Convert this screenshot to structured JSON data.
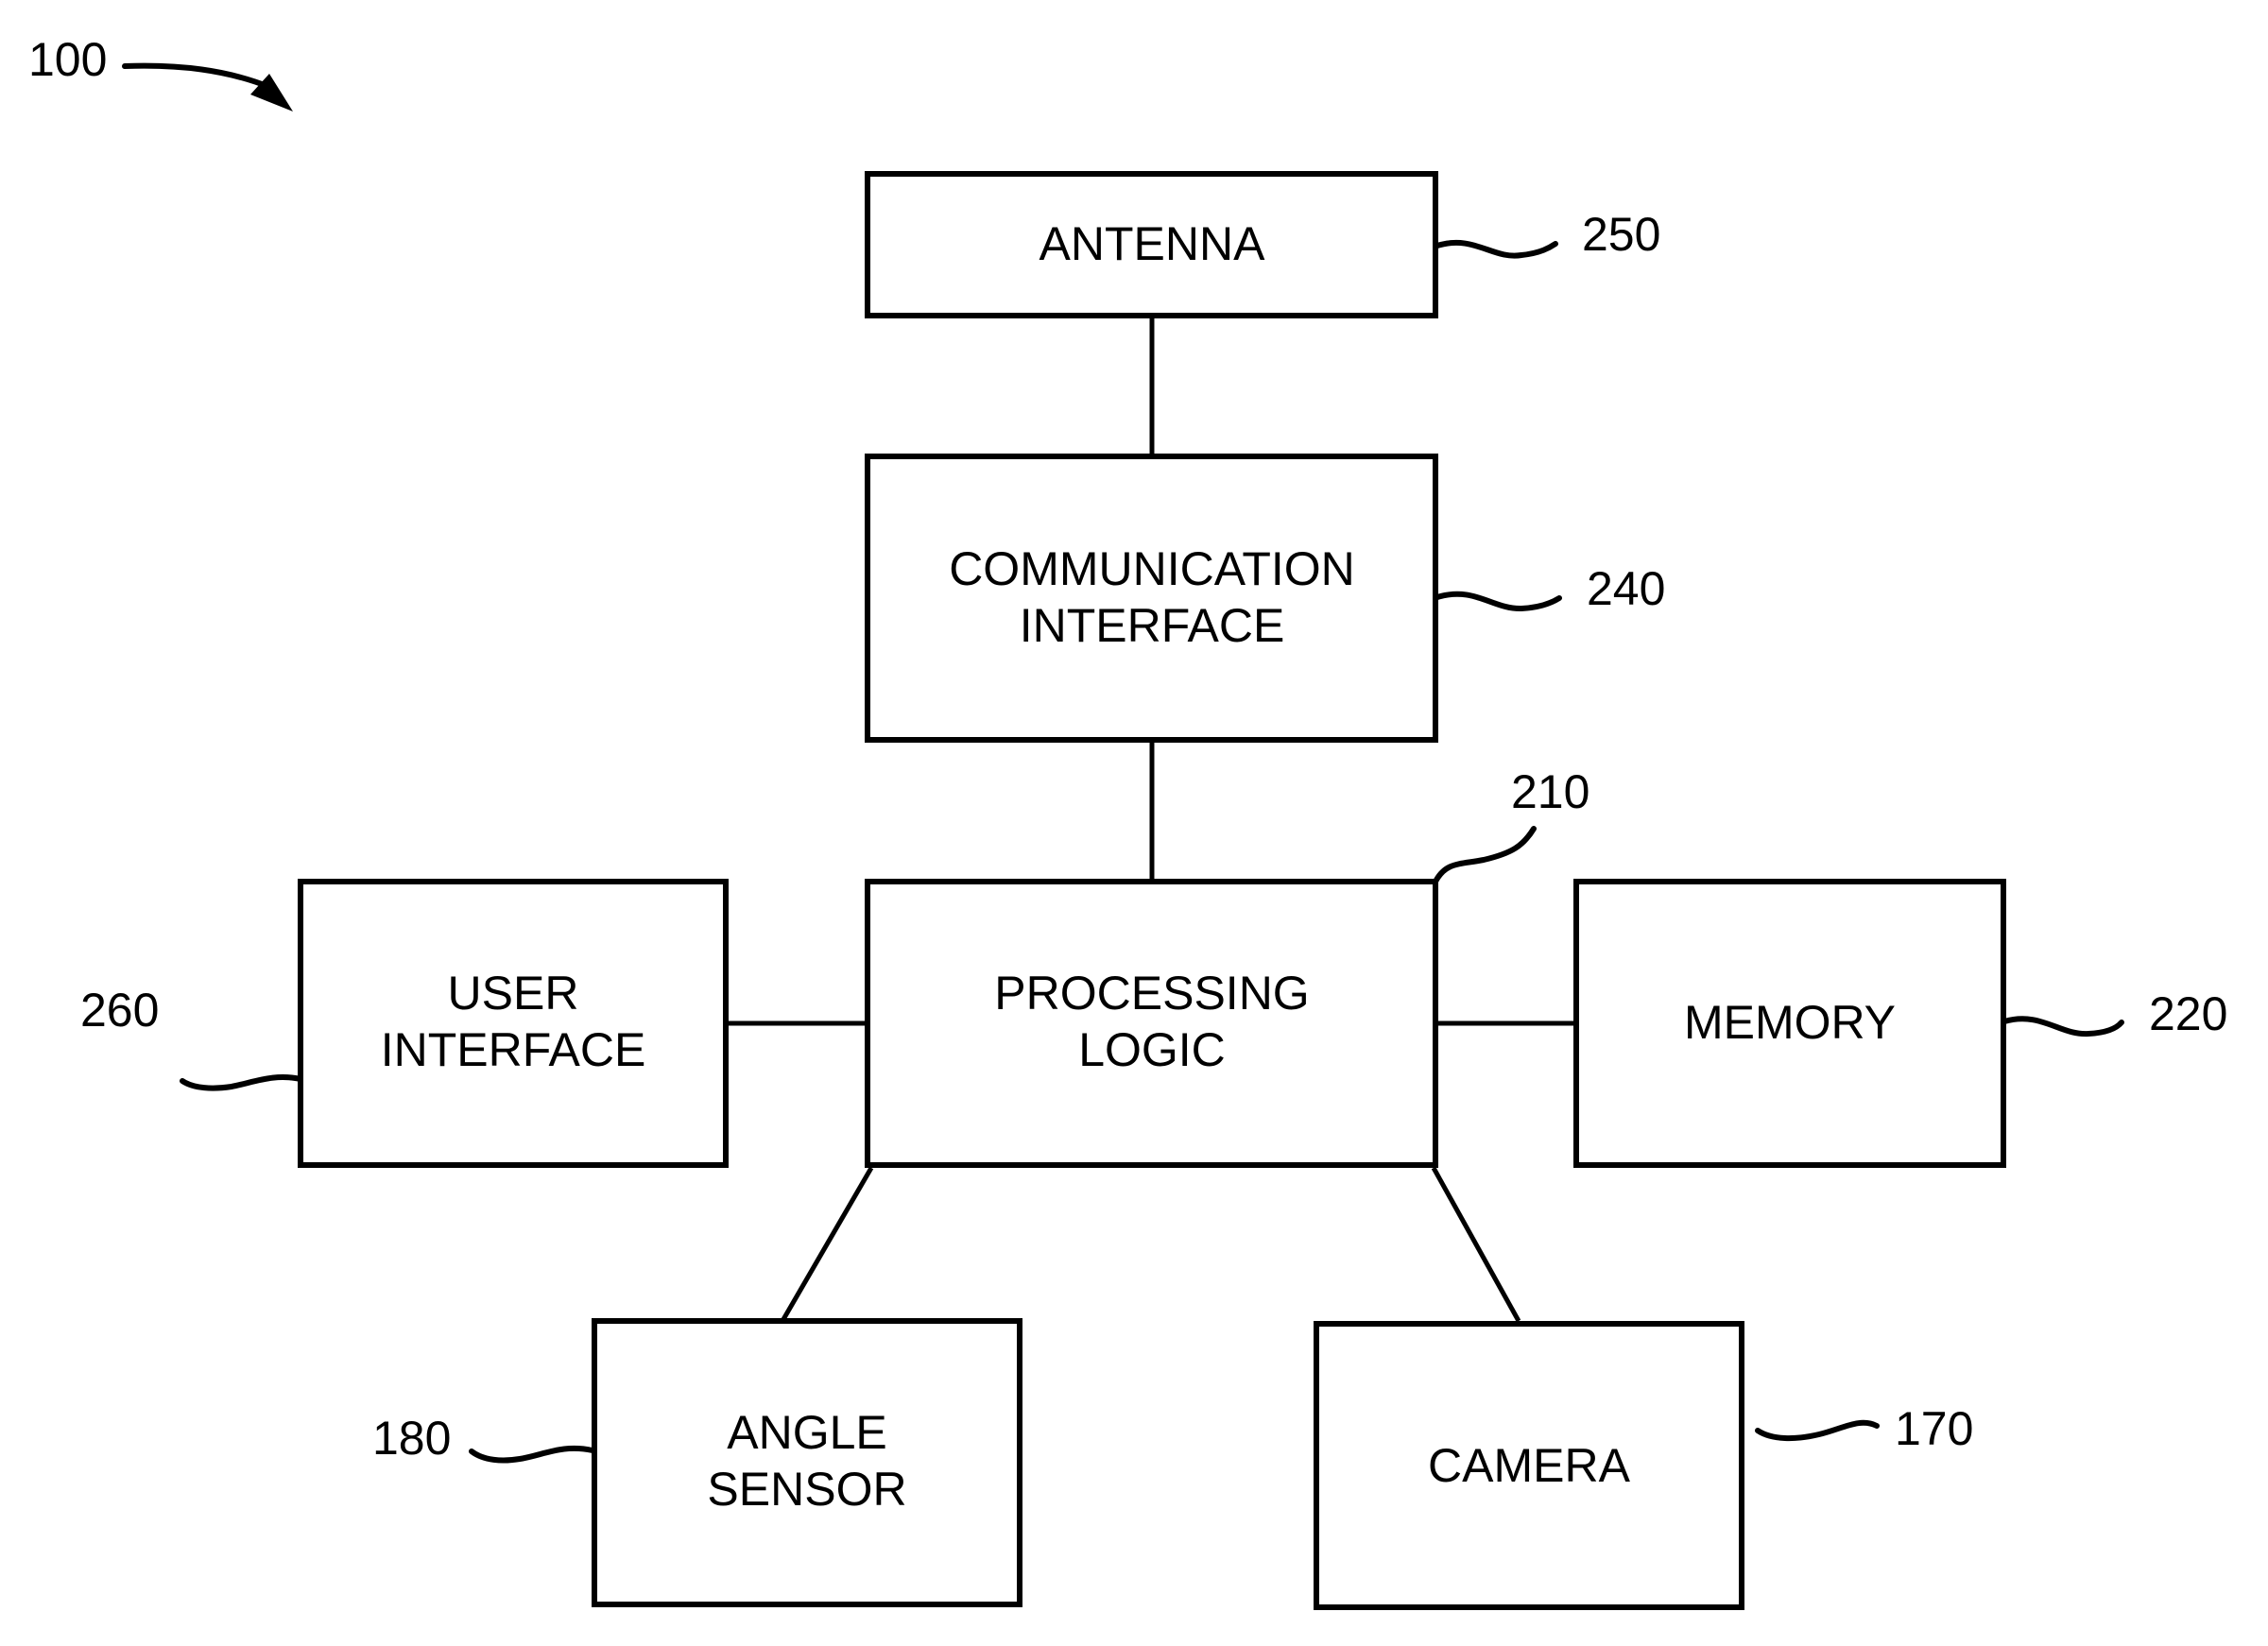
{
  "figure": {
    "ref": "100",
    "arrow_icon": "curved-arrow-icon"
  },
  "blocks": {
    "antenna": {
      "lines": [
        "ANTENNA"
      ],
      "ref": "250"
    },
    "communication_interface": {
      "lines": [
        "COMMUNICATION",
        "INTERFACE"
      ],
      "ref": "240"
    },
    "processing_logic": {
      "lines": [
        "PROCESSING",
        "LOGIC"
      ],
      "ref": "210"
    },
    "user_interface": {
      "lines": [
        "USER",
        "INTERFACE"
      ],
      "ref": "260"
    },
    "memory": {
      "lines": [
        "MEMORY"
      ],
      "ref": "220"
    },
    "angle_sensor": {
      "lines": [
        "ANGLE",
        "SENSOR"
      ],
      "ref": "180"
    },
    "camera": {
      "lines": [
        "CAMERA"
      ],
      "ref": "170"
    }
  },
  "connections": [
    [
      "antenna",
      "communication_interface"
    ],
    [
      "communication_interface",
      "processing_logic"
    ],
    [
      "user_interface",
      "processing_logic"
    ],
    [
      "processing_logic",
      "memory"
    ],
    [
      "processing_logic",
      "angle_sensor"
    ],
    [
      "processing_logic",
      "camera"
    ]
  ]
}
